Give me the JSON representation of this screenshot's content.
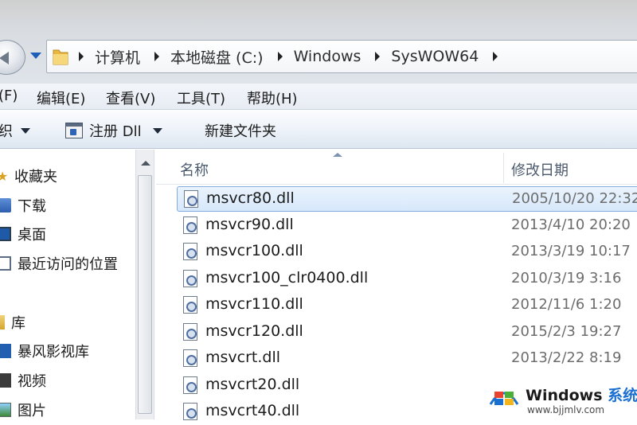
{
  "address_bar": {
    "breadcrumbs": [
      "计算机",
      "本地磁盘 (C:)",
      "Windows",
      "SysWOW64"
    ]
  },
  "menu": {
    "items": [
      "(F)",
      "编辑(E)",
      "查看(V)",
      "工具(T)",
      "帮助(H)"
    ]
  },
  "toolbar": {
    "organize_fragment": "织",
    "register_dll": "注册 Dll",
    "new_folder": "新建文件夹"
  },
  "nav": {
    "favorites_label": "收藏夹",
    "downloads": "下载",
    "desktop": "桌面",
    "recent_places": "最近访问的位置",
    "libraries_label": "库",
    "storm_library": "暴风影视库",
    "videos": "视频",
    "pictures": "图片"
  },
  "columns": {
    "name": "名称",
    "date_modified": "修改日期"
  },
  "files": [
    {
      "name": "msvcr80.dll",
      "date": "2005/10/20 22:32",
      "selected": true
    },
    {
      "name": "msvcr90.dll",
      "date": "2013/4/10 20:20"
    },
    {
      "name": "msvcr100.dll",
      "date": "2013/3/19 10:17"
    },
    {
      "name": "msvcr100_clr0400.dll",
      "date": "2010/3/19 3:16"
    },
    {
      "name": "msvcr110.dll",
      "date": "2012/11/6 1:20"
    },
    {
      "name": "msvcr120.dll",
      "date": "2015/2/3 19:27"
    },
    {
      "name": "msvcrt.dll",
      "date": "2013/2/22 8:19"
    },
    {
      "name": "msvcrt20.dll",
      "date": ""
    },
    {
      "name": "msvcrt40.dll",
      "date": ""
    }
  ],
  "watermark": {
    "brand": "Windows",
    "brand_cn": "系统之家",
    "url": "www.bjjmlv.com"
  },
  "colors": {
    "accent": "#1b6fd1",
    "selection_border": "#84acdd"
  }
}
